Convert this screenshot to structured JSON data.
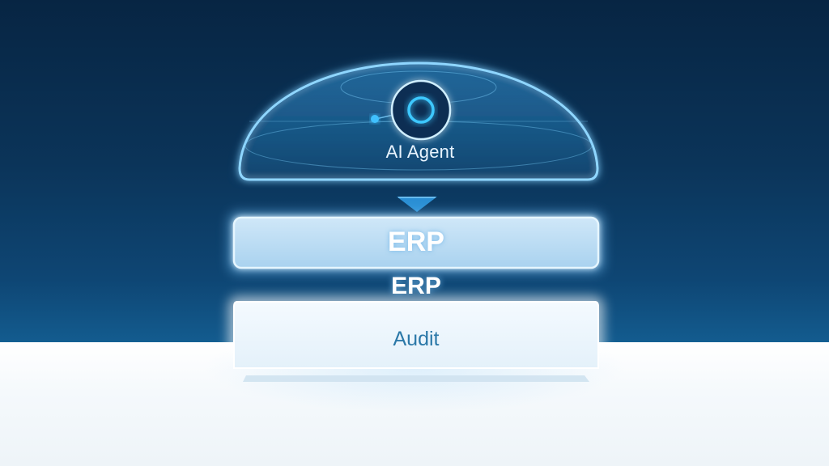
{
  "agent": {
    "label": "AI Agent"
  },
  "erp_box": {
    "label": "ERP"
  },
  "erp_float": {
    "label": "ERP"
  },
  "audit_box": {
    "label": "Audit"
  },
  "colors": {
    "background_top": "#072543",
    "background_bottom": "#135b8e",
    "glow": "#5cc4ff",
    "floor": "#f5f9fc",
    "audit_text": "#2b78a8"
  },
  "icons": {
    "agent_core": "ring-icon",
    "flow": "arrow-down-icon"
  }
}
